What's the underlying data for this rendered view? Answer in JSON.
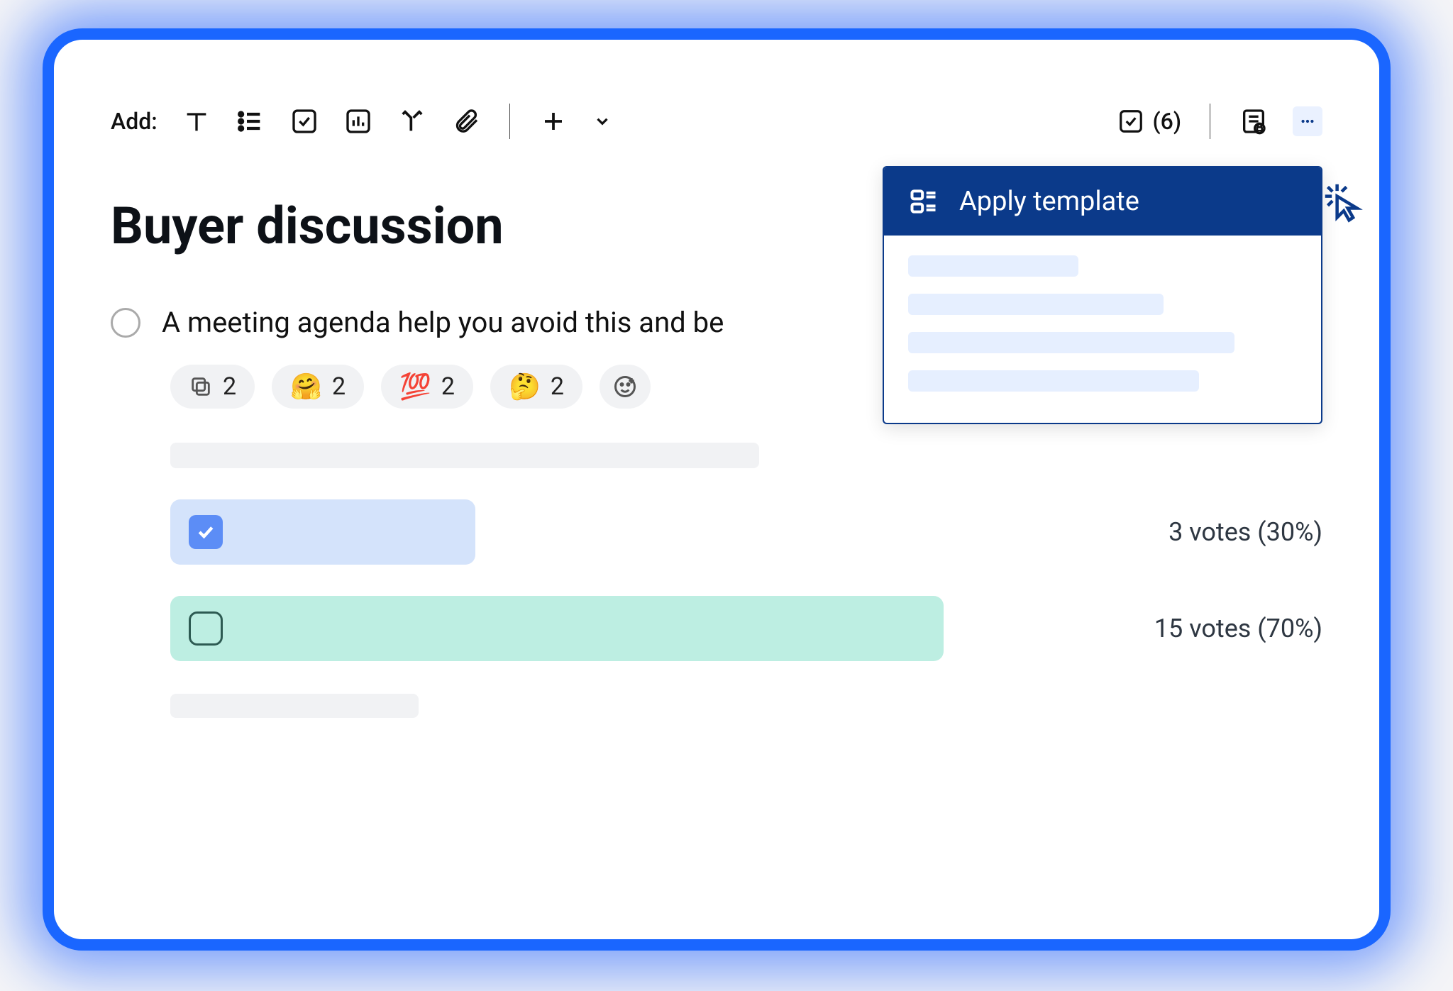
{
  "toolbar": {
    "add_label": "Add:",
    "icons": {
      "text": "text-icon",
      "list": "list-icon",
      "checkbox": "checkbox-icon",
      "poll": "chart-icon",
      "decision": "fork-icon",
      "attachment": "paperclip-icon",
      "plus": "plus-icon",
      "chevron": "chevron-down-icon"
    },
    "task_count": "(6)",
    "private_note": "private-notes-icon",
    "more": "more-icon"
  },
  "document": {
    "title": "Buyer discussion"
  },
  "agenda": {
    "text": "A meeting agenda help you avoid this and be "
  },
  "reactions": [
    {
      "icon": "copy-icon",
      "glyph": "⧉",
      "count": "2"
    },
    {
      "icon": "hug-emoji",
      "glyph": "🤗",
      "count": "2"
    },
    {
      "icon": "100-emoji",
      "glyph": "💯",
      "count": "2"
    },
    {
      "icon": "think-emoji",
      "glyph": "🤔",
      "count": "2"
    }
  ],
  "add_reaction_icon": "add-reaction-icon",
  "poll": {
    "options": [
      {
        "checked": true,
        "votes_label": "3 votes (30%)"
      },
      {
        "checked": false,
        "votes_label": "15 votes (70%)"
      }
    ]
  },
  "dropdown": {
    "apply_template_label": "Apply template"
  },
  "colors": {
    "accent": "#1a66ff",
    "navy": "#0b3a8a",
    "bar_blue": "#d4e3fb",
    "bar_teal": "#bdeee2"
  }
}
